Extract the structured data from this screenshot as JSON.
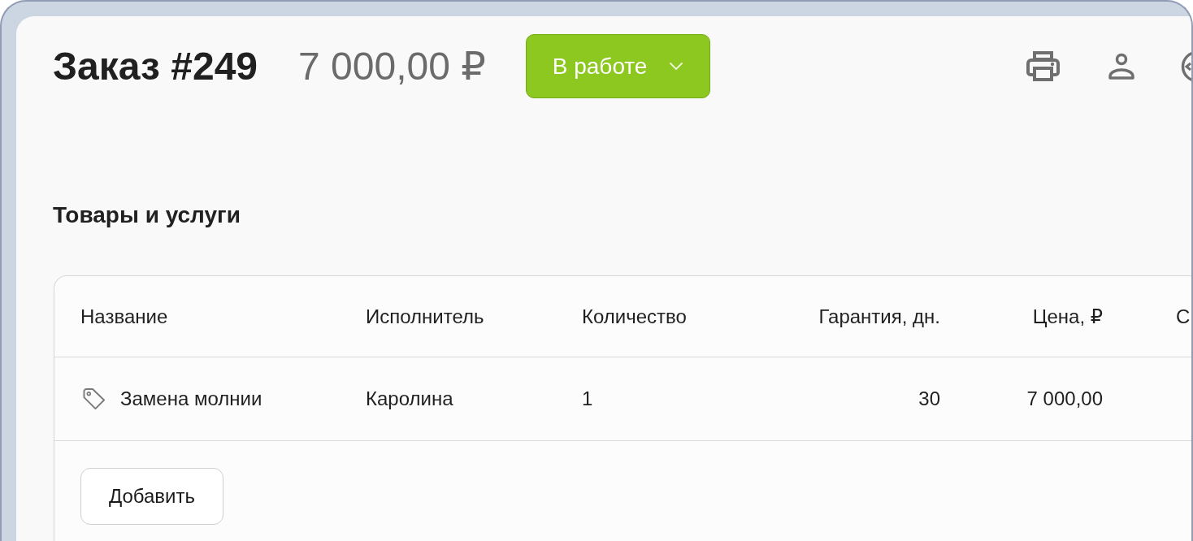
{
  "header": {
    "title": "Заказ #249",
    "total": "7 000,00 ₽",
    "status_button": {
      "label": "В работе"
    }
  },
  "section": {
    "title": "Товары и услуги"
  },
  "table": {
    "columns": [
      {
        "label": "Название",
        "kind": "text"
      },
      {
        "label": "Исполнитель",
        "kind": "text"
      },
      {
        "label": "Количество",
        "kind": "text"
      },
      {
        "label": "Гарантия, дн.",
        "kind": "number"
      },
      {
        "label": "Цена, ₽",
        "kind": "number"
      },
      {
        "label": "С",
        "kind": "text"
      }
    ],
    "rows": [
      {
        "kind": "service",
        "cells": [
          "Замена молнии",
          "Каролина",
          "1",
          "30",
          "7 000,00"
        ]
      }
    ]
  },
  "add_button": {
    "label": "Добавить"
  }
}
